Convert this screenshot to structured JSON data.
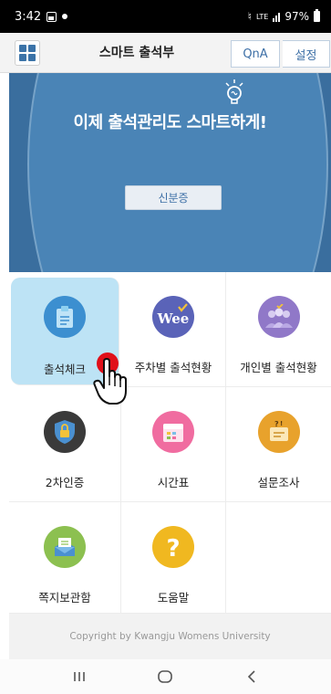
{
  "status_bar": {
    "time": "3:42",
    "battery": "97%",
    "network": "LTE"
  },
  "header": {
    "title": "스마트 출석부",
    "qna_label": "QnA",
    "settings_label": "설정"
  },
  "banner": {
    "headline": "이제 출석관리도 스마트하게!",
    "button_label": "신분증"
  },
  "menu": {
    "items": [
      {
        "label": "출석체크",
        "icon": "clipboard-icon",
        "color": "#3c8fd0"
      },
      {
        "label": "주차별 출석현황",
        "icon": "week-icon",
        "color": "#5a63b8"
      },
      {
        "label": "개인별 출석현황",
        "icon": "people-icon",
        "color": "#9078c8"
      },
      {
        "label": "2차인증",
        "icon": "shield-lock-icon",
        "color": "#3a3a3a"
      },
      {
        "label": "시간표",
        "icon": "calendar-icon",
        "color": "#f06ca0"
      },
      {
        "label": "설문조사",
        "icon": "survey-icon",
        "color": "#e8a22c"
      },
      {
        "label": "쪽지보관함",
        "icon": "mailbox-icon",
        "color": "#8cc050"
      },
      {
        "label": "도움말",
        "icon": "question-icon",
        "color": "#f0b820"
      }
    ]
  },
  "footer": {
    "copyright": "Copyright by Kwangju Womens University"
  },
  "colors": {
    "banner": "#3a6e9e",
    "accent": "#3d6fa6",
    "active_cell": "#bde3f5"
  }
}
